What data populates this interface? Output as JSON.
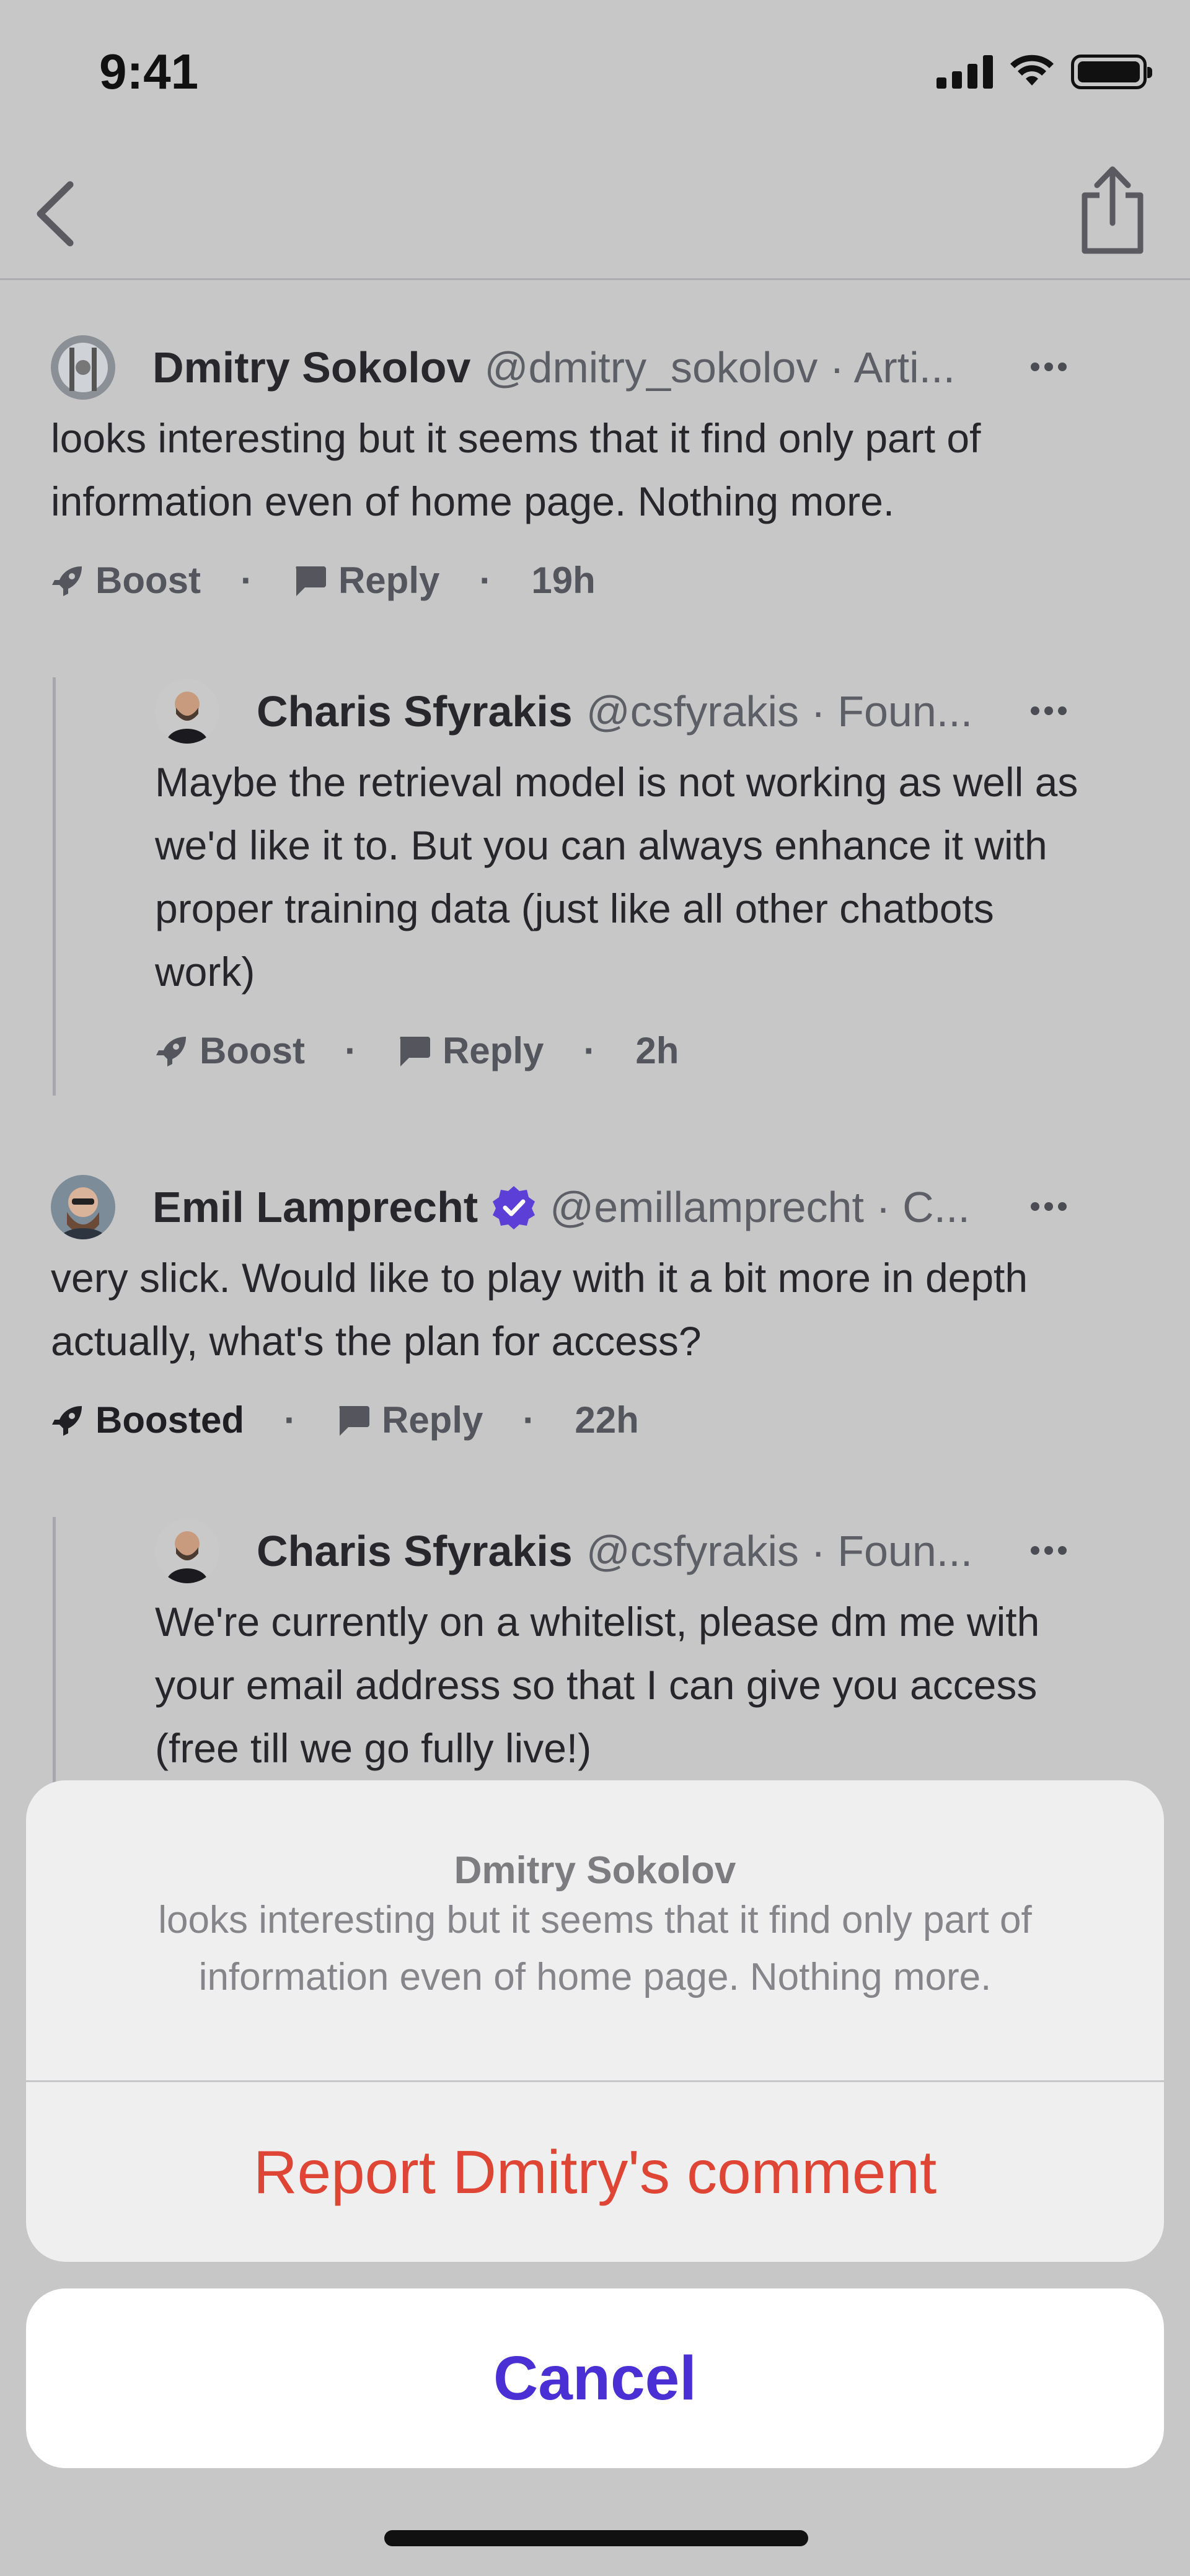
{
  "status_bar": {
    "time": "9:41"
  },
  "nav": {
    "back_icon": "chevron-left-icon",
    "share_icon": "share-icon"
  },
  "comments": [
    {
      "author": "Dmitry Sokolov",
      "handle": "@dmitry_sokolov · Arti...",
      "body": "looks interesting but it seems that it find only part of information even of home page. Nothing more.",
      "boost_label": "Boost",
      "reply_label": "Reply",
      "time": "19h"
    },
    {
      "author": "Charis Sfyrakis",
      "handle": "@csfyrakis · Foun...",
      "body": "Maybe the retrieval model is not working as well as we'd like it to. But you can always enhance it with proper training data (just like all other chatbots work)",
      "boost_label": "Boost",
      "reply_label": "Reply",
      "time": "2h"
    },
    {
      "author": "Emil Lamprecht",
      "handle": "@emillamprecht · C...",
      "verified": true,
      "body": "very slick. Would like to play with it a bit more in depth actually, what's the plan for access?",
      "boost_label": "Boosted",
      "reply_label": "Reply",
      "time": "22h"
    },
    {
      "author": "Charis Sfyrakis",
      "handle": "@csfyrakis · Foun...",
      "body": "We're currently on a whitelist, please dm me with your email address so that I can give you access (free till we go fully live!)"
    }
  ],
  "action_sheet": {
    "title": "Dmitry Sokolov",
    "message": "looks interesting but it seems that it find only part of information even of home page. Nothing more.",
    "report_label": "Report Dmitry's comment",
    "cancel_label": "Cancel"
  },
  "colors": {
    "report": "#de4535",
    "cancel": "#4a2fd4",
    "verified": "#5b3fd6"
  }
}
